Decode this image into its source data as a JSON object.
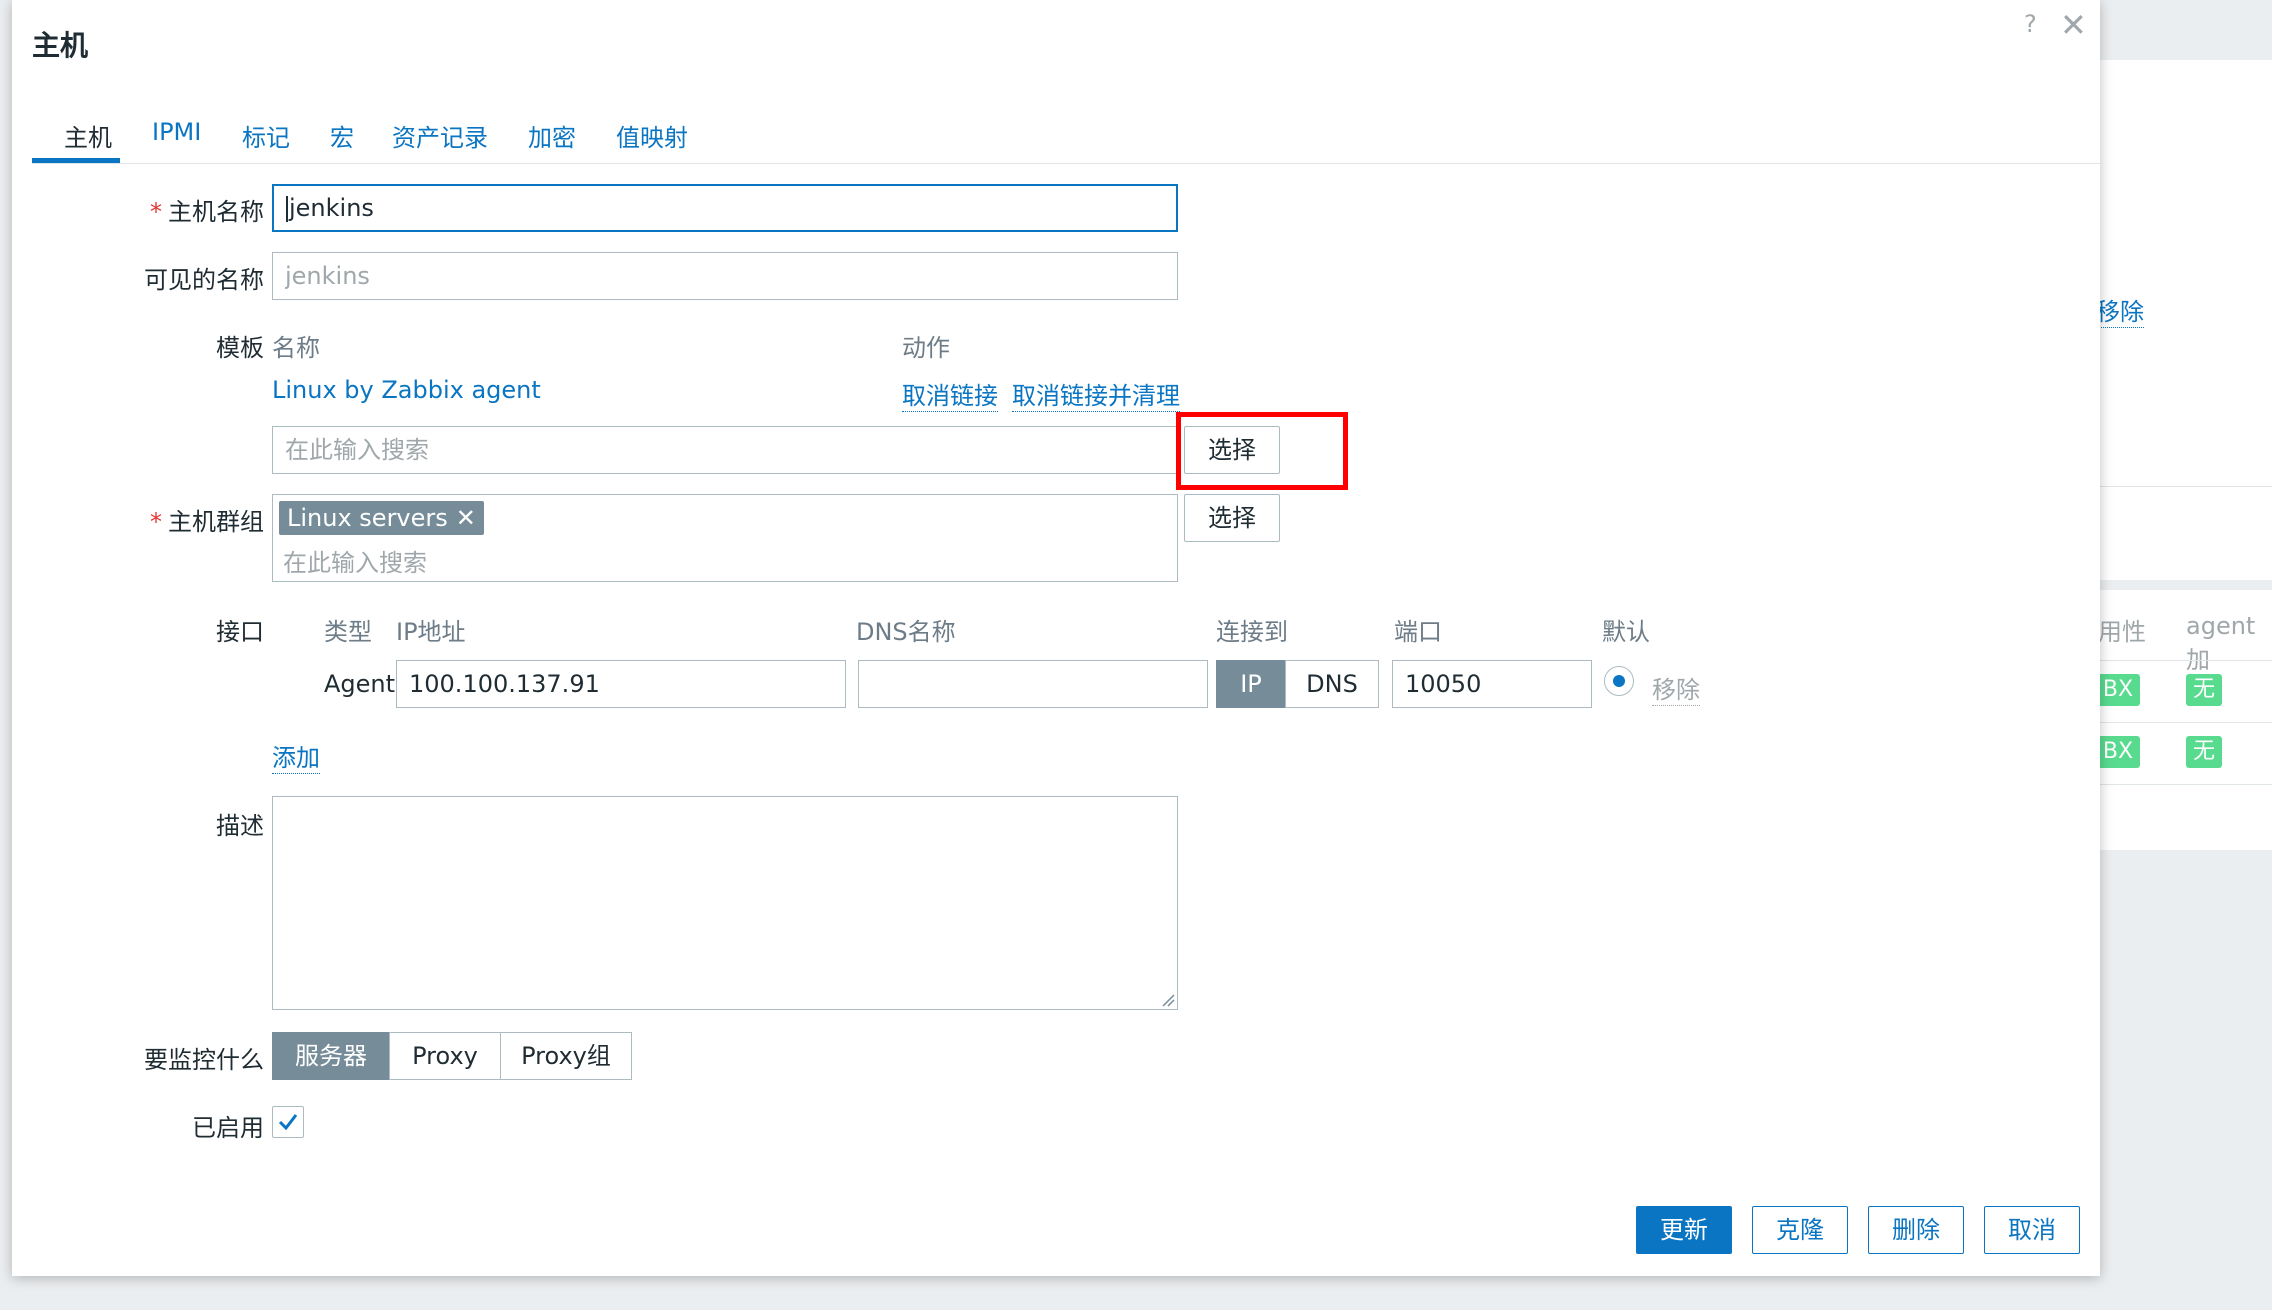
{
  "background": {
    "remove_link": "移除",
    "col_availability": "用性",
    "col_agent": "agent 加",
    "row_tags": [
      "BX",
      "BX"
    ],
    "row_status": [
      "无",
      "无"
    ]
  },
  "dialog": {
    "title": "主机",
    "help": "?",
    "close": "✕"
  },
  "tabs": [
    "主机",
    "IPMI",
    "标记",
    "宏",
    "资产记录",
    "加密",
    "值映射"
  ],
  "form": {
    "hostname_label": "主机名称",
    "hostname_value": "jenkins",
    "visible_name_label": "可见的名称",
    "visible_name_placeholder": "jenkins",
    "templates_label": "模板",
    "templates_col_name": "名称",
    "templates_col_action": "动作",
    "template_name": "Linux by Zabbix agent",
    "unlink": "取消链接",
    "unlink_clear": "取消链接并清理",
    "template_search_placeholder": "在此输入搜索",
    "select_button": "选择",
    "host_groups_label": "主机群组",
    "host_group_chip": "Linux servers",
    "host_group_search_placeholder": "在此输入搜索",
    "host_groups_select_button": "选择",
    "interfaces_label": "接口",
    "interfaces_cols": {
      "type": "类型",
      "ip": "IP地址",
      "dns": "DNS名称",
      "connect_to": "连接到",
      "port": "端口",
      "default": "默认"
    },
    "interface": {
      "type": "Agent",
      "ip": "100.100.137.91",
      "dns": "",
      "connect_ip": "IP",
      "connect_dns": "DNS",
      "port": "10050",
      "remove": "移除"
    },
    "add_link": "添加",
    "description_label": "描述",
    "monitored_by_label": "要监控什么",
    "monitored_by_options": [
      "服务器",
      "Proxy",
      "Proxy组"
    ],
    "enabled_label": "已启用"
  },
  "footer": {
    "update": "更新",
    "clone": "克隆",
    "delete": "删除",
    "cancel": "取消"
  }
}
